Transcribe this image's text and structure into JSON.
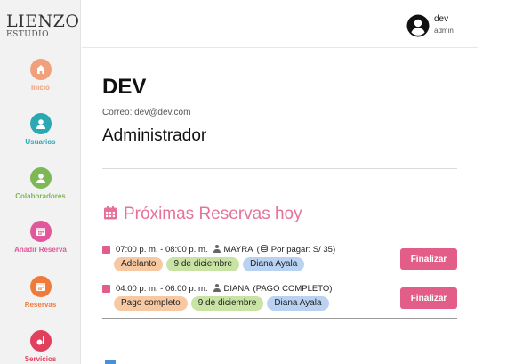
{
  "brand": {
    "name": "LIENZO",
    "sub": "ESTUDIO"
  },
  "sidebar": {
    "items": [
      {
        "label": "Inicio",
        "icon": "home-icon",
        "color": "#f0a07a",
        "text_color": "#f0a07a"
      },
      {
        "label": "Usuarios",
        "icon": "user-icon",
        "color": "#2aa9b4",
        "text_color": "#2aa9b4"
      },
      {
        "label": "Colaboradores",
        "icon": "user-icon",
        "color": "#7cb856",
        "text_color": "#7cb856"
      },
      {
        "label": "Añadir Reserva",
        "icon": "calendar-icon",
        "color": "#e0579a",
        "text_color": "#e0579a"
      },
      {
        "label": "Reservas",
        "icon": "calendar-icon",
        "color": "#ef7a3a",
        "text_color": "#ef7a3a"
      },
      {
        "label": "Servicios",
        "icon": "services-icon",
        "color": "#e0405e",
        "text_color": "#e0405e"
      }
    ]
  },
  "header": {
    "user_name": "dev",
    "user_role": "admin"
  },
  "profile": {
    "title": "DEV",
    "email_line": "Correo: dev@dev.com",
    "role": "Administrador"
  },
  "reservations": {
    "heading": "Próximas Reservas hoy",
    "heading_color": "#e8719b",
    "button_label": "Finalizar",
    "items": [
      {
        "time": "07:00 p. m. - 08:00 p. m.",
        "client": "MAYRA",
        "status": "Por pagar: S/ 35)",
        "status_prefix": "(",
        "status_icon": "money-icon",
        "tags": [
          {
            "text": "Adelanto",
            "color": "#f6c9a3"
          },
          {
            "text": "9 de diciembre",
            "color": "#c9e3a4"
          },
          {
            "text": "Diana Ayala",
            "color": "#b9d2f2"
          }
        ]
      },
      {
        "time": "04:00 p. m. - 06:00 p. m.",
        "client": "DIANA",
        "status": "(PAGO COMPLETO)",
        "status_prefix": "",
        "status_icon": "",
        "tags": [
          {
            "text": "Pago completo",
            "color": "#f6c9a3"
          },
          {
            "text": "9 de diciembre",
            "color": "#c9e3a4"
          },
          {
            "text": "Diana Ayala",
            "color": "#b9d2f2"
          }
        ]
      }
    ]
  }
}
